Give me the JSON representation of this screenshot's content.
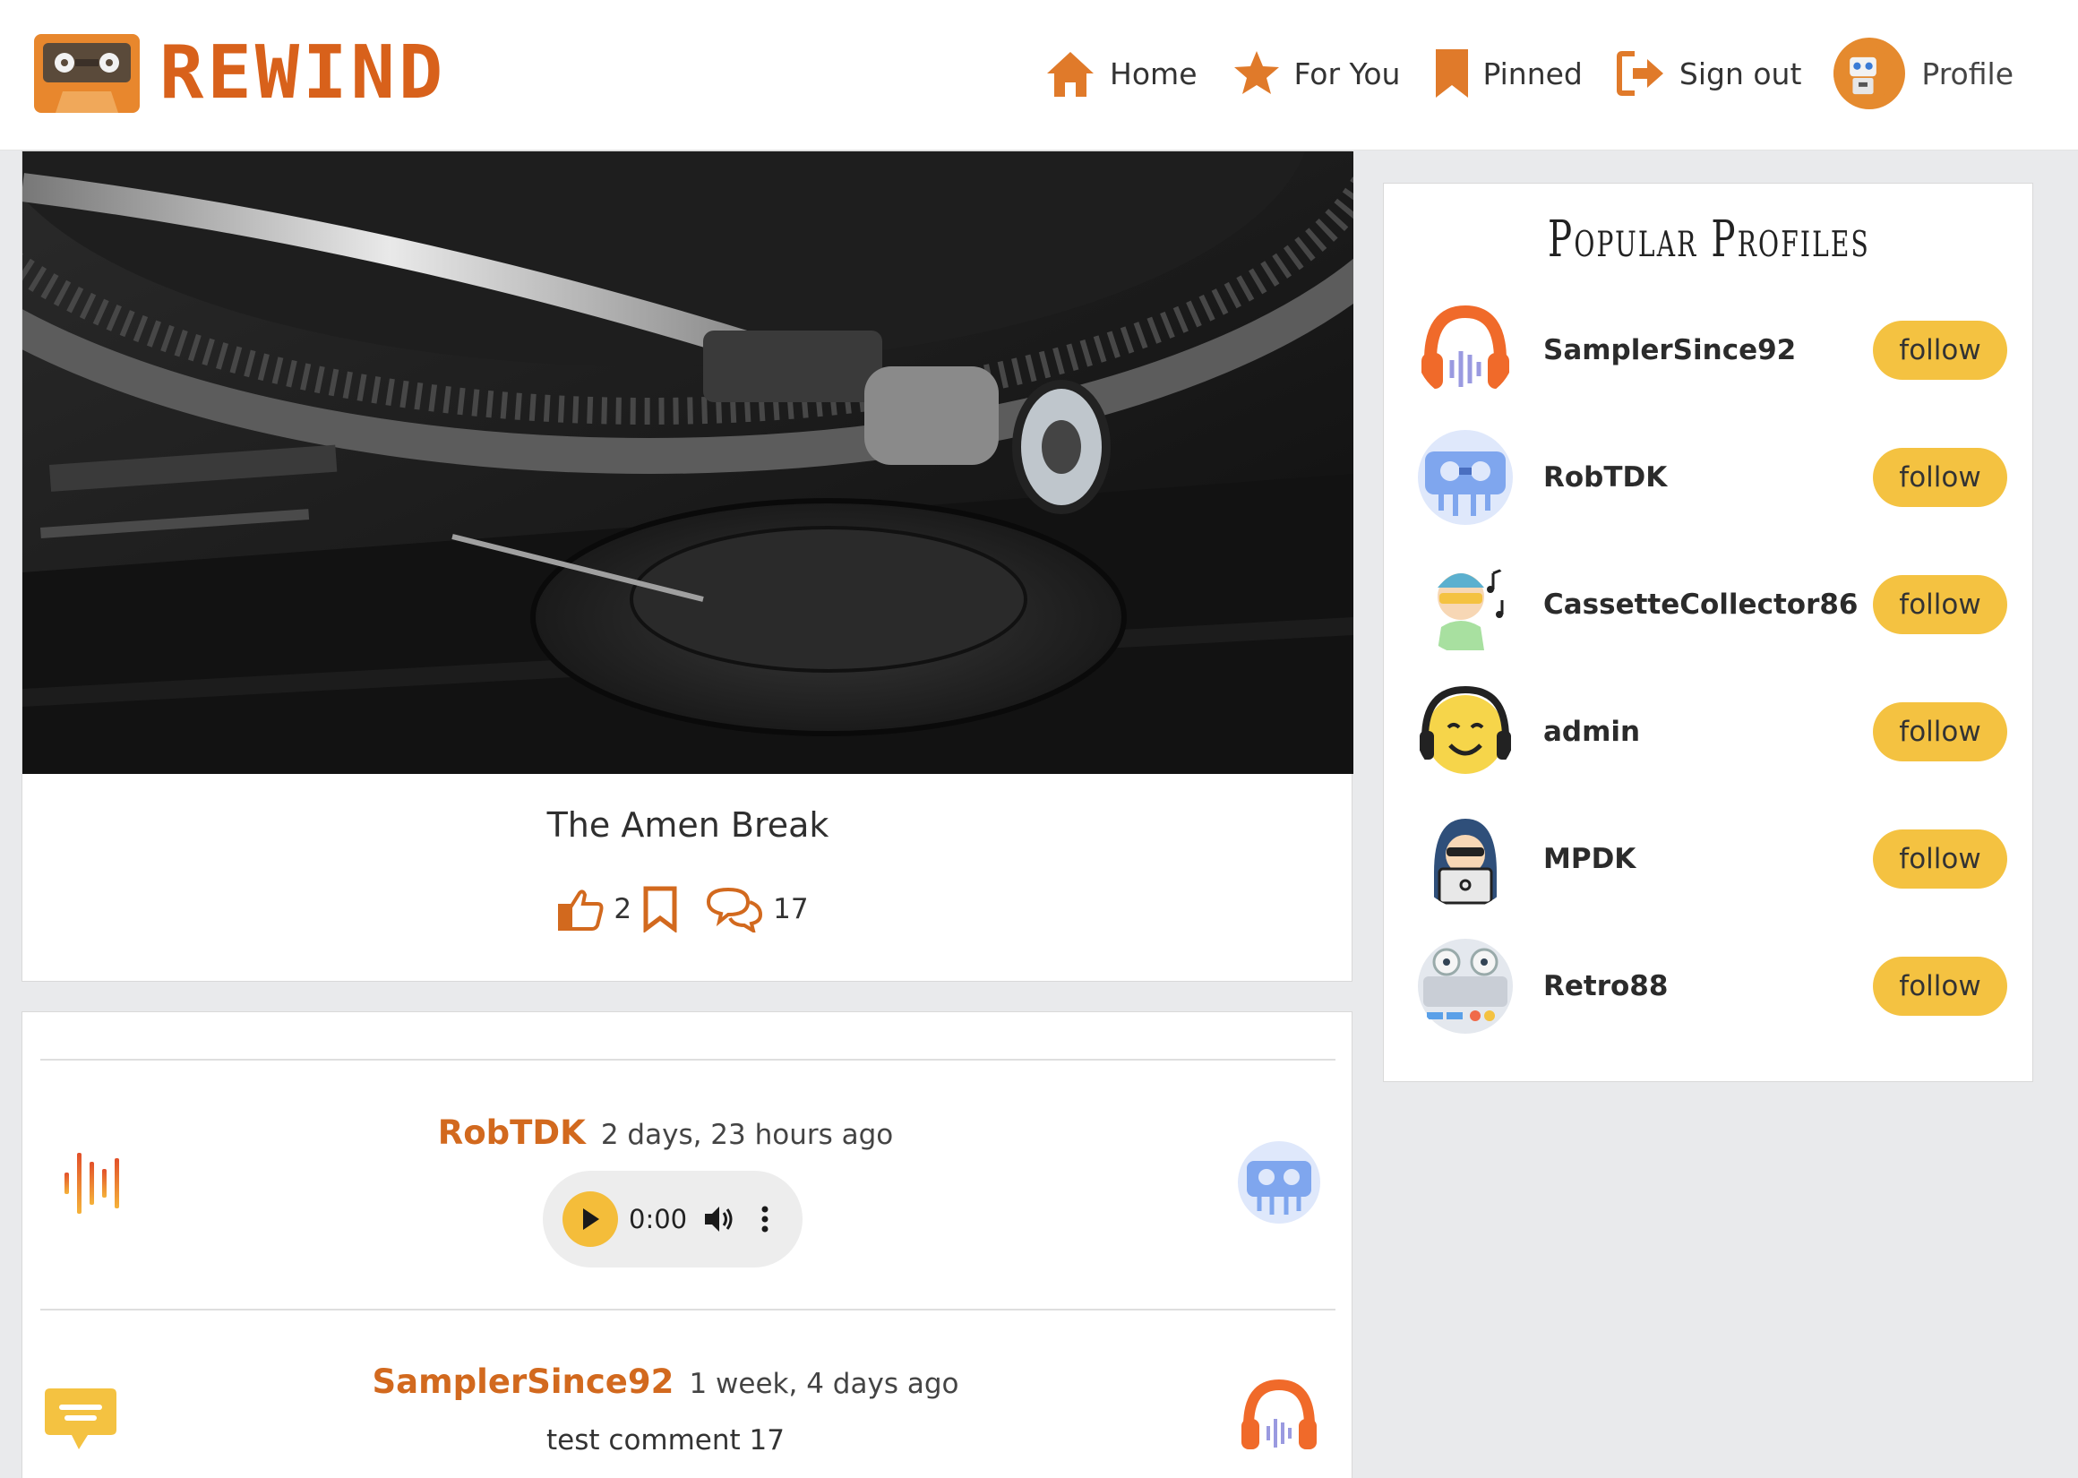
{
  "brand": {
    "name": "REWIND"
  },
  "nav": {
    "home": "Home",
    "for_you": "For You",
    "pinned": "Pinned",
    "sign_out": "Sign out",
    "profile": "Profile"
  },
  "post": {
    "title": "The Amen Break",
    "likes": "2",
    "comments": "17"
  },
  "comments": [
    {
      "user": "RobTDK",
      "time": "2 days, 23 hours ago",
      "audio_time": "0:00"
    },
    {
      "user": "SamplerSince92",
      "time": "1 week, 4 days ago",
      "text": "test comment 17"
    }
  ],
  "sidebar": {
    "title": "Popular Profiles",
    "follow_label": "follow",
    "profiles": [
      {
        "name": "SamplerSince92"
      },
      {
        "name": "RobTDK"
      },
      {
        "name": "CassetteCollector86"
      },
      {
        "name": "admin"
      },
      {
        "name": "MPDK"
      },
      {
        "name": "Retro88"
      }
    ]
  },
  "colors": {
    "accent": "#d2691e",
    "follow": "#f4c241",
    "brand": "#d8611b"
  }
}
